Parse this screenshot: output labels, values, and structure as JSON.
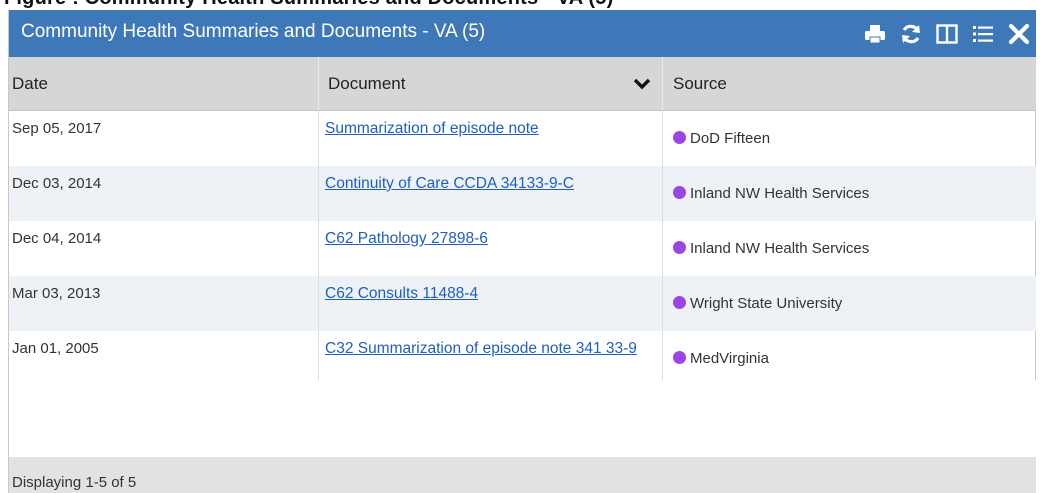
{
  "page_heading_partial": "Figure : Community Health Summaries and Documents - VA (5)",
  "panel": {
    "title": "Community Health Summaries and Documents - VA (5)",
    "toolbar": [
      {
        "icon": "print-icon",
        "label": "Print"
      },
      {
        "icon": "refresh-icon",
        "label": "Refresh"
      },
      {
        "icon": "columns-icon",
        "label": "Columns"
      },
      {
        "icon": "list-icon",
        "label": "List"
      },
      {
        "icon": "close-icon",
        "label": "Close"
      }
    ]
  },
  "table": {
    "columns": [
      "Date",
      "Document",
      "Source"
    ],
    "rows": [
      {
        "date": "Sep 05, 2017",
        "document": "Summarization of episode note",
        "source": "DoD Fifteen"
      },
      {
        "date": "Dec 03, 2014",
        "document": "Continuity of Care CCDA 34133-9-C",
        "source": "Inland NW Health Services"
      },
      {
        "date": "Dec 04, 2014",
        "document": "C62 Pathology 27898-6",
        "source": "Inland NW Health Services"
      },
      {
        "date": "Mar 03, 2013",
        "document": "C62 Consults 11488-4",
        "source": "Wright State University"
      },
      {
        "date": "Jan 01, 2005",
        "document": "C32 Summarization of episode note 341 33-9",
        "source": "MedVirginia"
      }
    ]
  },
  "footer": {
    "status": "Displaying 1-5 of 5"
  },
  "colors": {
    "title_bar": "#3e78b8",
    "source_dot": "#9b45e6",
    "link": "#1f5fbf",
    "header_bg": "#d6d6d6",
    "footer_bg": "#e2e2e2"
  }
}
